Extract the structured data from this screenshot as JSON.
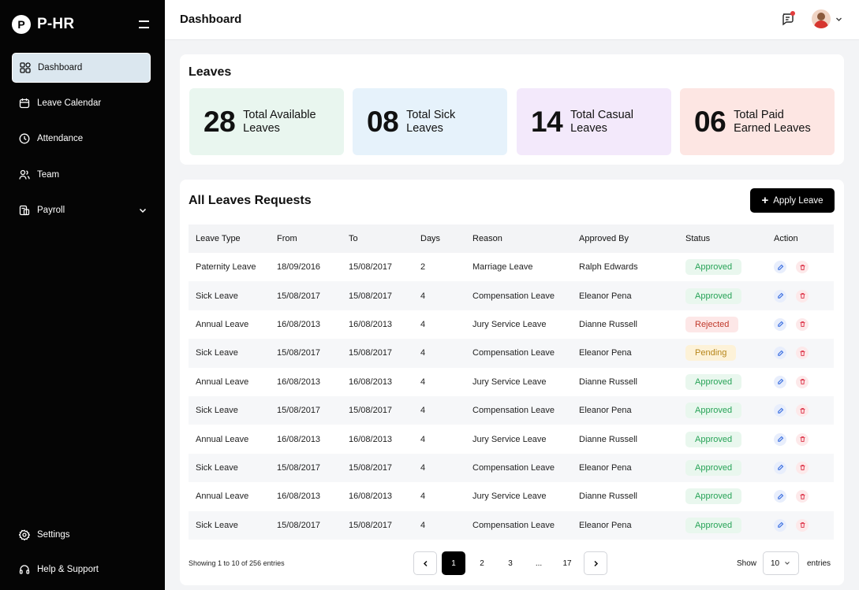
{
  "brand": {
    "logo": "P",
    "name": "P-HR"
  },
  "sidebar": {
    "items": [
      {
        "label": "Dashboard",
        "icon": "grid-icon"
      },
      {
        "label": "Leave Calendar",
        "icon": "calendar-icon"
      },
      {
        "label": "Attendance",
        "icon": "clock-icon"
      },
      {
        "label": "Team",
        "icon": "team-icon"
      },
      {
        "label": "Payroll",
        "icon": "payroll-icon"
      }
    ],
    "bottom": [
      {
        "label": "Settings",
        "icon": "gear-icon"
      },
      {
        "label": "Help & Support",
        "icon": "headset-icon"
      }
    ]
  },
  "header": {
    "title": "Dashboard"
  },
  "leaves": {
    "title": "Leaves",
    "stats": [
      {
        "num": "28",
        "label": "Total Available\nLeaves",
        "color": "#e9f6ef"
      },
      {
        "num": "08",
        "label": "Total Sick\nLeaves",
        "color": "#e6f2fb"
      },
      {
        "num": "14",
        "label": "Total Casual\nLeaves",
        "color": "#f3e9fb"
      },
      {
        "num": "06",
        "label": "Total Paid\nEarned Leaves",
        "color": "#fde6e3"
      }
    ]
  },
  "requests": {
    "title": "All Leaves Requests",
    "apply_label": "Apply Leave",
    "columns": [
      "Leave Type",
      "From",
      "To",
      "Days",
      "Reason",
      "Approved By",
      "Status",
      "Action"
    ],
    "rows": [
      {
        "type": "Paternity Leave",
        "from": "18/09/2016",
        "to": "15/08/2017",
        "days": "2",
        "reason": "Marriage Leave",
        "by": "Ralph Edwards",
        "status": "Approved"
      },
      {
        "type": "Sick Leave",
        "from": "15/08/2017",
        "to": "15/08/2017",
        "days": "4",
        "reason": "Compensation Leave",
        "by": "Eleanor Pena",
        "status": "Approved"
      },
      {
        "type": "Annual Leave",
        "from": "16/08/2013",
        "to": "16/08/2013",
        "days": "4",
        "reason": "Jury Service Leave",
        "by": "Dianne Russell",
        "status": "Rejected"
      },
      {
        "type": "Sick Leave",
        "from": "15/08/2017",
        "to": "15/08/2017",
        "days": "4",
        "reason": "Compensation Leave",
        "by": "Eleanor Pena",
        "status": "Pending"
      },
      {
        "type": "Annual Leave",
        "from": "16/08/2013",
        "to": "16/08/2013",
        "days": "4",
        "reason": "Jury Service Leave",
        "by": "Dianne Russell",
        "status": "Approved"
      },
      {
        "type": "Sick Leave",
        "from": "15/08/2017",
        "to": "15/08/2017",
        "days": "4",
        "reason": "Compensation Leave",
        "by": "Eleanor Pena",
        "status": "Approved"
      },
      {
        "type": "Annual Leave",
        "from": "16/08/2013",
        "to": "16/08/2013",
        "days": "4",
        "reason": "Jury Service Leave",
        "by": "Dianne Russell",
        "status": "Approved"
      },
      {
        "type": "Sick Leave",
        "from": "15/08/2017",
        "to": "15/08/2017",
        "days": "4",
        "reason": "Compensation Leave",
        "by": "Eleanor Pena",
        "status": "Approved"
      },
      {
        "type": "Annual Leave",
        "from": "16/08/2013",
        "to": "16/08/2013",
        "days": "4",
        "reason": "Jury Service Leave",
        "by": "Dianne Russell",
        "status": "Approved"
      },
      {
        "type": "Sick Leave",
        "from": "15/08/2017",
        "to": "15/08/2017",
        "days": "4",
        "reason": "Compensation Leave",
        "by": "Eleanor Pena",
        "status": "Approved"
      }
    ],
    "footer": {
      "showing": "Showing 1 to 10 of 256 entries",
      "pages": [
        "1",
        "2",
        "3",
        "...",
        "17"
      ],
      "current_page": "1",
      "show_label": "Show",
      "page_size": "10",
      "entries_label": "entries"
    }
  },
  "colors": {
    "sidebar": "#050505",
    "approved": "#27a357",
    "rejected": "#c0392b",
    "pending": "#b7861b"
  }
}
